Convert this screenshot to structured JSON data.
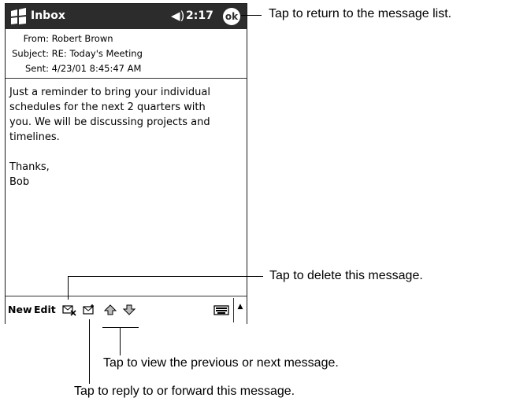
{
  "device": {
    "app_title": "Inbox",
    "clock": "2:17",
    "ok_label": "ok",
    "icons": {
      "start": "windows-flag-icon",
      "volume": "speaker-icon"
    }
  },
  "message": {
    "from_label": "From:",
    "from_value": "Robert Brown",
    "subject_label": "Subject:",
    "subject_value": "RE: Today's Meeting",
    "sent_label": "Sent:",
    "sent_value": "4/23/01 8:45:47 AM",
    "body": "Just a reminder to bring your individual\nschedules for the next 2 quarters with\nyou. We will be discussing projects and\ntimelines.\n\nThanks,\nBob"
  },
  "toolbar": {
    "new_label": "New",
    "edit_label": "Edit",
    "icons": [
      "delete-icon",
      "reply-forward-icon",
      "previous-message-icon",
      "next-message-icon",
      "keyboard-icon",
      "scroll-up-icon"
    ]
  },
  "callouts": {
    "ok": "Tap to return to the message list.",
    "delete": "Tap to delete this message.",
    "prev_next": "Tap to view the previous or next message.",
    "reply": "Tap to reply to or forward this message."
  }
}
